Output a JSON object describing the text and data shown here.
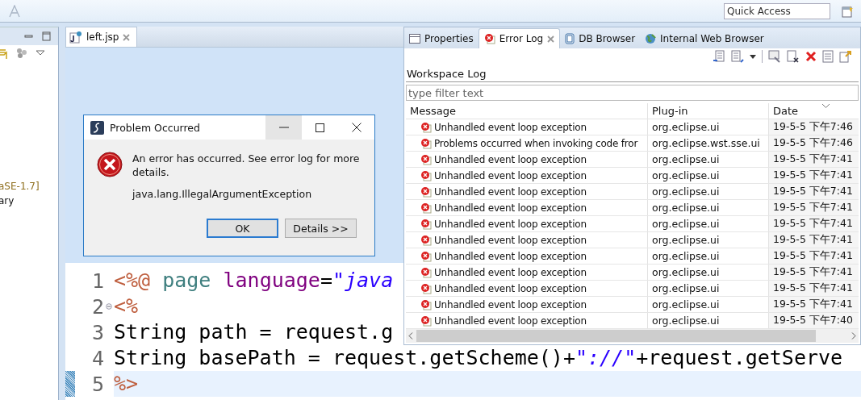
{
  "toolbar": {
    "quick_access": {
      "placeholder": "Quick Access"
    }
  },
  "left_panel": {
    "lines": [
      {
        "text": "aSE-1.7]",
        "kind": "decoration"
      },
      {
        "text": "ary",
        "kind": "plain"
      }
    ]
  },
  "editor": {
    "tab": {
      "label": "left.jsp",
      "selected": true
    },
    "code": [
      {
        "number": "1",
        "current": false,
        "tokens": [
          {
            "text": "<%@",
            "kind": "tag"
          },
          {
            "text": " page",
            "kind": "directive"
          },
          {
            "text": " language",
            "kind": "attr"
          },
          {
            "text": "=",
            "kind": "plain"
          },
          {
            "text": "\"java",
            "kind": "string"
          }
        ]
      },
      {
        "number": "2",
        "current": false,
        "tokens": [
          {
            "text": "<%",
            "kind": "tag"
          }
        ]
      },
      {
        "number": "3",
        "current": false,
        "tokens": [
          {
            "text": "String path = request.g",
            "kind": "plain"
          }
        ]
      },
      {
        "number": "4",
        "current": false,
        "tokens": [
          {
            "text": "String basePath = request.getScheme()+",
            "kind": "plain"
          },
          {
            "text": "\"://\"",
            "kind": "string"
          },
          {
            "text": "+request.getServe",
            "kind": "plain"
          }
        ]
      },
      {
        "number": "5",
        "current": true,
        "tokens": [
          {
            "text": "%>",
            "kind": "tag"
          }
        ]
      }
    ]
  },
  "error_log": {
    "tabs": [
      {
        "label": "Properties",
        "selected": false,
        "kind": "properties"
      },
      {
        "label": "Error Log",
        "selected": true,
        "kind": "log"
      },
      {
        "label": "DB Browser",
        "selected": false,
        "kind": "database"
      },
      {
        "label": "Internal Web Browser",
        "selected": false,
        "kind": "browser"
      }
    ],
    "title": "Workspace Log",
    "filter": {
      "placeholder": "type filter text"
    },
    "columns": [
      "Message",
      "Plug-in",
      "Date"
    ],
    "rows": [
      {
        "message": "Unhandled event loop exception",
        "plugin": "org.eclipse.ui",
        "date": "19-5-5 下午7:46"
      },
      {
        "message": "Problems occurred when invoking code fror",
        "plugin": "org.eclipse.wst.sse.ui",
        "date": "19-5-5 下午7:46"
      },
      {
        "message": "Unhandled event loop exception",
        "plugin": "org.eclipse.ui",
        "date": "19-5-5 下午7:41"
      },
      {
        "message": "Unhandled event loop exception",
        "plugin": "org.eclipse.ui",
        "date": "19-5-5 下午7:41"
      },
      {
        "message": "Unhandled event loop exception",
        "plugin": "org.eclipse.ui",
        "date": "19-5-5 下午7:41"
      },
      {
        "message": "Unhandled event loop exception",
        "plugin": "org.eclipse.ui",
        "date": "19-5-5 下午7:41"
      },
      {
        "message": "Unhandled event loop exception",
        "plugin": "org.eclipse.ui",
        "date": "19-5-5 下午7:41"
      },
      {
        "message": "Unhandled event loop exception",
        "plugin": "org.eclipse.ui",
        "date": "19-5-5 下午7:41"
      },
      {
        "message": "Unhandled event loop exception",
        "plugin": "org.eclipse.ui",
        "date": "19-5-5 下午7:41"
      },
      {
        "message": "Unhandled event loop exception",
        "plugin": "org.eclipse.ui",
        "date": "19-5-5 下午7:41"
      },
      {
        "message": "Unhandled event loop exception",
        "plugin": "org.eclipse.ui",
        "date": "19-5-5 下午7:41"
      },
      {
        "message": "Unhandled event loop exception",
        "plugin": "org.eclipse.ui",
        "date": "19-5-5 下午7:41"
      },
      {
        "message": "Unhandled event loop exception",
        "plugin": "org.eclipse.ui",
        "date": "19-5-5 下午7:40"
      }
    ]
  },
  "dialog": {
    "title": "Problem Occurred",
    "message": "An error has occurred. See error log for more details.",
    "detail": "java.lang.IllegalArgumentException",
    "buttons": [
      {
        "label": "OK",
        "selected": true
      },
      {
        "label": "Details >>",
        "selected": false
      }
    ]
  }
}
